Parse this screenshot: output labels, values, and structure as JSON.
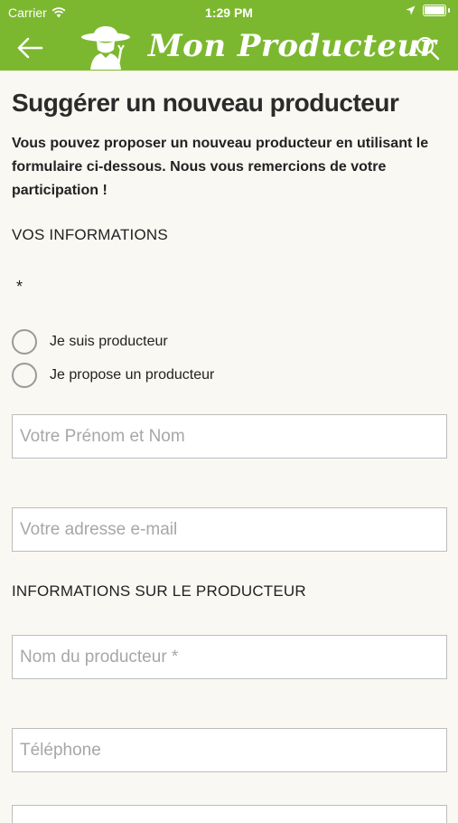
{
  "status_bar": {
    "carrier": "Carrier",
    "time": "1:29 PM"
  },
  "header": {
    "brand": "Mon Producteur",
    "background_color": "#7cb82f"
  },
  "page": {
    "title": "Suggérer un nouveau producteur",
    "intro": "Vous pouvez proposer un nouveau producteur en utilisant le formulaire ci-dessous. Nous vous remercions de votre participation !"
  },
  "form": {
    "section_user": "VOS INFORMATIONS",
    "required_marker": "*",
    "radio_options": [
      {
        "label": "Je suis producteur",
        "checked": false
      },
      {
        "label": "Je propose un producteur",
        "checked": false
      }
    ],
    "name_placeholder": "Votre Prénom et Nom",
    "email_placeholder": "Votre adresse e-mail",
    "section_producer": "INFORMATIONS SUR LE PRODUCTEUR",
    "producer_name_placeholder": "Nom du producteur *",
    "phone_placeholder": "Téléphone"
  }
}
